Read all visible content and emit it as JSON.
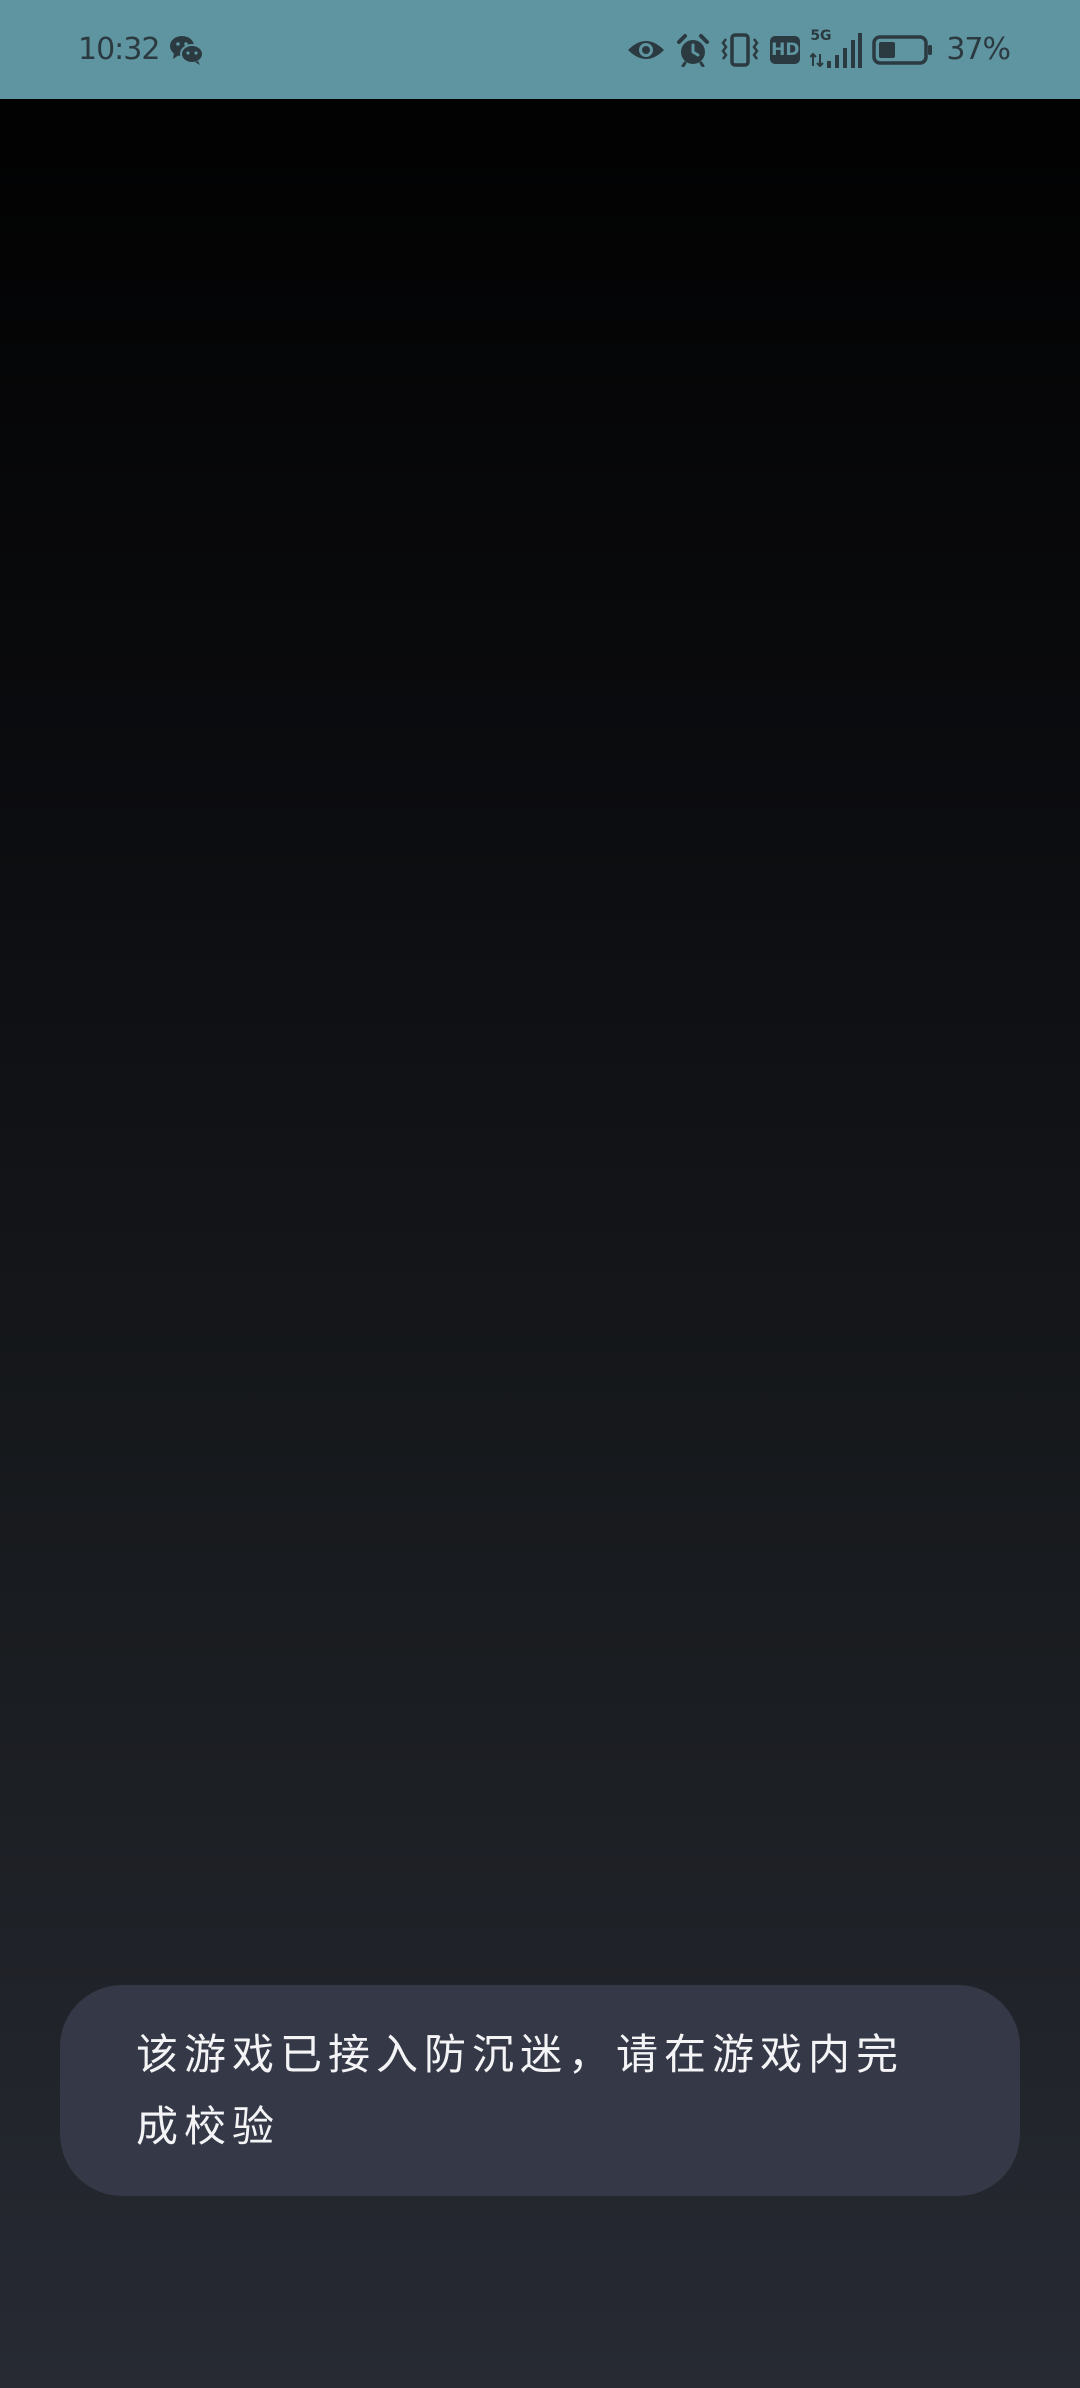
{
  "status_bar": {
    "time": "10:32",
    "network_type": "5G",
    "hd_label": "HD",
    "battery_percent": "37%",
    "battery_level": 0.37,
    "icons": [
      "wechat-icon",
      "eye-icon",
      "alarm-icon",
      "vibrate-icon",
      "hd-icon",
      "signal-icon",
      "battery-icon"
    ],
    "colors": {
      "background": "#5f95a0",
      "foreground": "#2b3a40"
    }
  },
  "toast": {
    "message": "该游戏已接入防沉迷，请在游戏内完成校验"
  }
}
